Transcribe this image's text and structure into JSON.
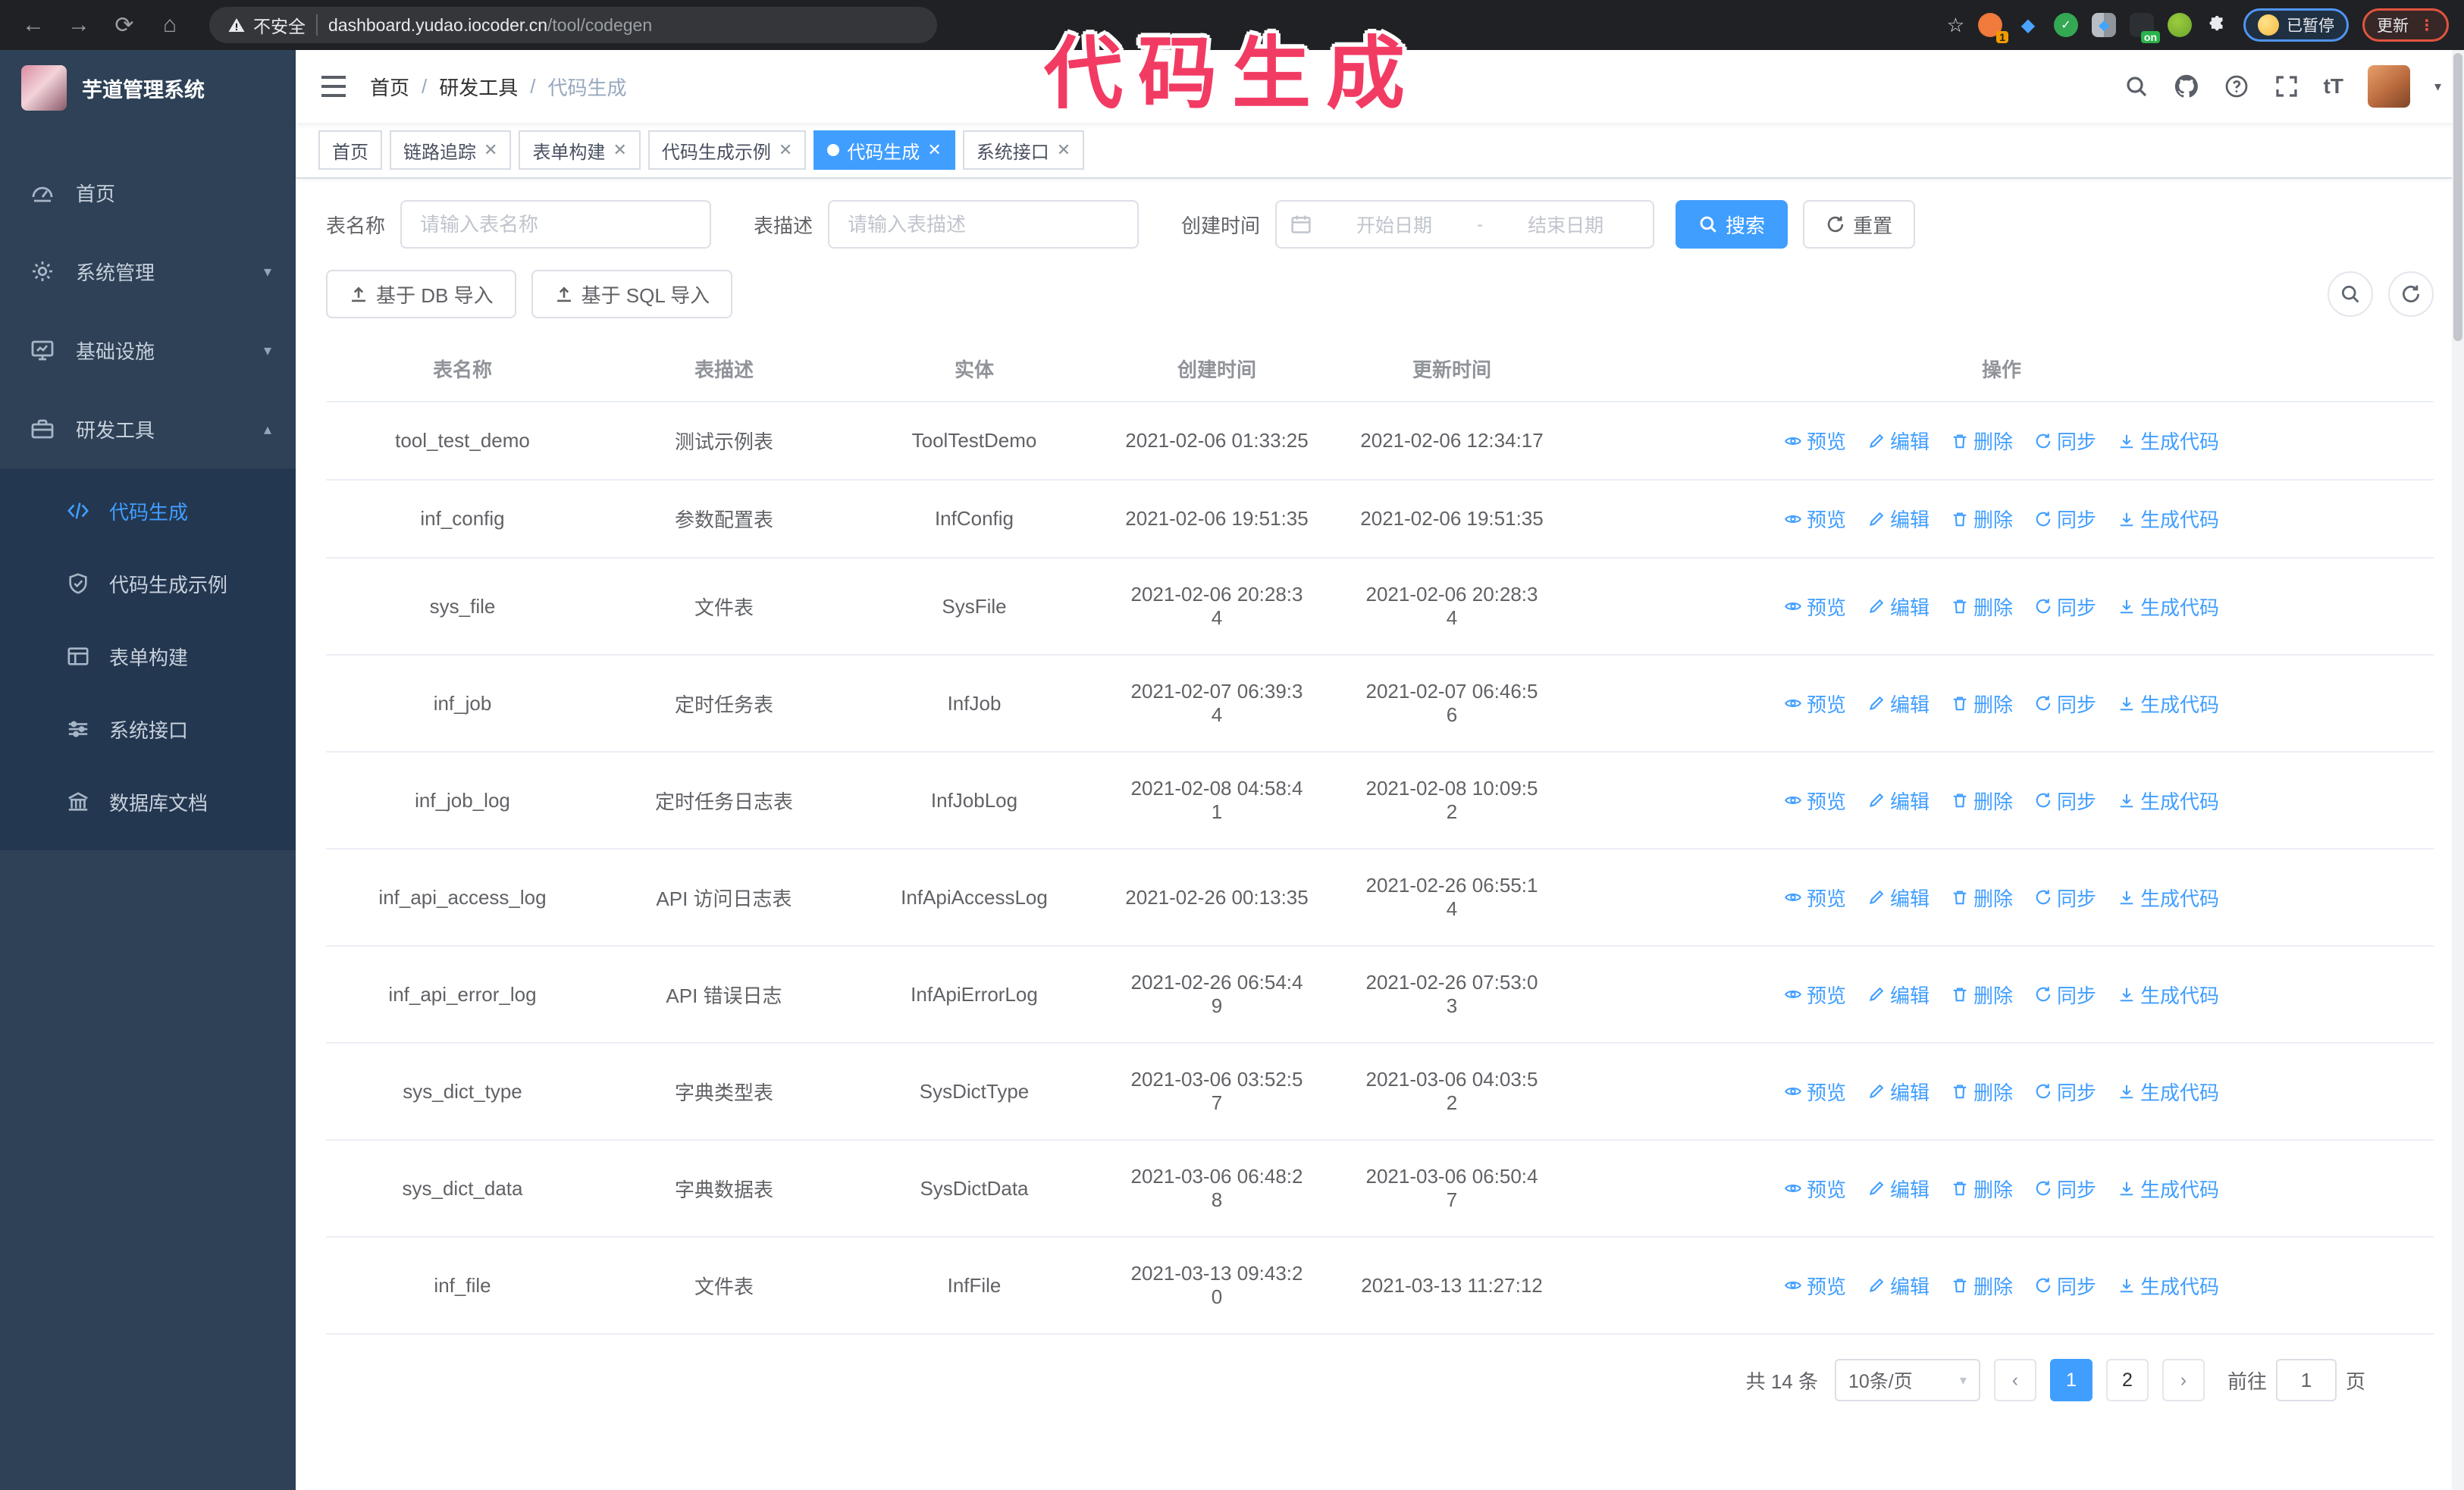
{
  "browser": {
    "security_label": "不安全",
    "url_host": "dashboard.yudao.iocoder.cn",
    "url_path": "/tool/codegen",
    "extension_badge": "1",
    "extension_on_badge": "on",
    "paused_badge": "已暂停",
    "update_button": "更新"
  },
  "annotation": {
    "text": "代码生成",
    "color": "#f23b63"
  },
  "sidebar": {
    "title": "芋道管理系统",
    "items": [
      {
        "label": "首页"
      },
      {
        "label": "系统管理"
      },
      {
        "label": "基础设施"
      },
      {
        "label": "研发工具"
      }
    ],
    "submenu": [
      {
        "label": "代码生成"
      },
      {
        "label": "代码生成示例"
      },
      {
        "label": "表单构建"
      },
      {
        "label": "系统接口"
      },
      {
        "label": "数据库文档"
      }
    ]
  },
  "header": {
    "breadcrumb": [
      "首页",
      "研发工具",
      "代码生成"
    ],
    "text_size_tool": "tT"
  },
  "tabs": [
    {
      "label": "首页"
    },
    {
      "label": "链路追踪"
    },
    {
      "label": "表单构建"
    },
    {
      "label": "代码生成示例"
    },
    {
      "label": "代码生成"
    },
    {
      "label": "系统接口"
    }
  ],
  "search": {
    "name_label": "表名称",
    "name_placeholder": "请输入表名称",
    "desc_label": "表描述",
    "desc_placeholder": "请输入表描述",
    "time_label": "创建时间",
    "start_placeholder": "开始日期",
    "range_separator": "-",
    "end_placeholder": "结束日期",
    "search_button": "搜索",
    "reset_button": "重置"
  },
  "toolbar": {
    "import_db": "基于 DB 导入",
    "import_sql": "基于 SQL 导入"
  },
  "table": {
    "columns": [
      "表名称",
      "表描述",
      "实体",
      "创建时间",
      "更新时间",
      "操作"
    ],
    "actions": [
      "预览",
      "编辑",
      "删除",
      "同步",
      "生成代码"
    ],
    "rows": [
      {
        "name": "tool_test_demo",
        "desc": "测试示例表",
        "entity": "ToolTestDemo",
        "created": "2021-02-06 01:33:25",
        "updated": "2021-02-06 12:34:17"
      },
      {
        "name": "inf_config",
        "desc": "参数配置表",
        "entity": "InfConfig",
        "created": "2021-02-06 19:51:35",
        "updated": "2021-02-06 19:51:35"
      },
      {
        "name": "sys_file",
        "desc": "文件表",
        "entity": "SysFile",
        "created": "2021-02-06 20:28:3\n4",
        "updated": "2021-02-06 20:28:3\n4"
      },
      {
        "name": "inf_job",
        "desc": "定时任务表",
        "entity": "InfJob",
        "created": "2021-02-07 06:39:3\n4",
        "updated": "2021-02-07 06:46:5\n6"
      },
      {
        "name": "inf_job_log",
        "desc": "定时任务日志表",
        "entity": "InfJobLog",
        "created": "2021-02-08 04:58:4\n1",
        "updated": "2021-02-08 10:09:5\n2"
      },
      {
        "name": "inf_api_access_log",
        "desc": "API 访问日志表",
        "entity": "InfApiAccessLog",
        "created": "2021-02-26 00:13:35",
        "updated": "2021-02-26 06:55:1\n4"
      },
      {
        "name": "inf_api_error_log",
        "desc": "API 错误日志",
        "entity": "InfApiErrorLog",
        "created": "2021-02-26 06:54:4\n9",
        "updated": "2021-02-26 07:53:0\n3"
      },
      {
        "name": "sys_dict_type",
        "desc": "字典类型表",
        "entity": "SysDictType",
        "created": "2021-03-06 03:52:5\n7",
        "updated": "2021-03-06 04:03:5\n2"
      },
      {
        "name": "sys_dict_data",
        "desc": "字典数据表",
        "entity": "SysDictData",
        "created": "2021-03-06 06:48:2\n8",
        "updated": "2021-03-06 06:50:4\n7"
      },
      {
        "name": "inf_file",
        "desc": "文件表",
        "entity": "InfFile",
        "created": "2021-03-13 09:43:2\n0",
        "updated": "2021-03-13 11:27:12"
      }
    ]
  },
  "pagination": {
    "total": "共 14 条",
    "page_size": "10条/页",
    "pages": [
      "1",
      "2"
    ],
    "active_page": "1",
    "goto_label": "前往",
    "goto_value": "1",
    "page_unit": "页"
  }
}
